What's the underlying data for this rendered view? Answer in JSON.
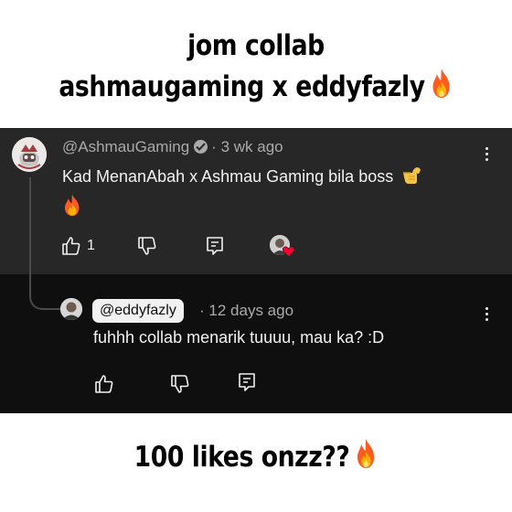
{
  "captions": {
    "top_line1": "jom collab",
    "top_line2": "ashmaugaming x eddyfazly",
    "bottom": "100 likes onzz??"
  },
  "comment": {
    "author": "@AshmauGaming",
    "time": "3 wk ago",
    "text": "Kad MenanAbah x Ashmau Gaming bila boss",
    "like_count": "1"
  },
  "reply": {
    "author": "@eddyfazly",
    "time": "12 days ago",
    "text": "fuhhh collab menarik tuuuu, mau ka? :D"
  },
  "colors": {
    "comment_bg": "#272727",
    "reply_bg": "#0f0f0f",
    "text": "#f1f1f1",
    "muted": "#aaaaaa",
    "heart": "#ff0033"
  }
}
